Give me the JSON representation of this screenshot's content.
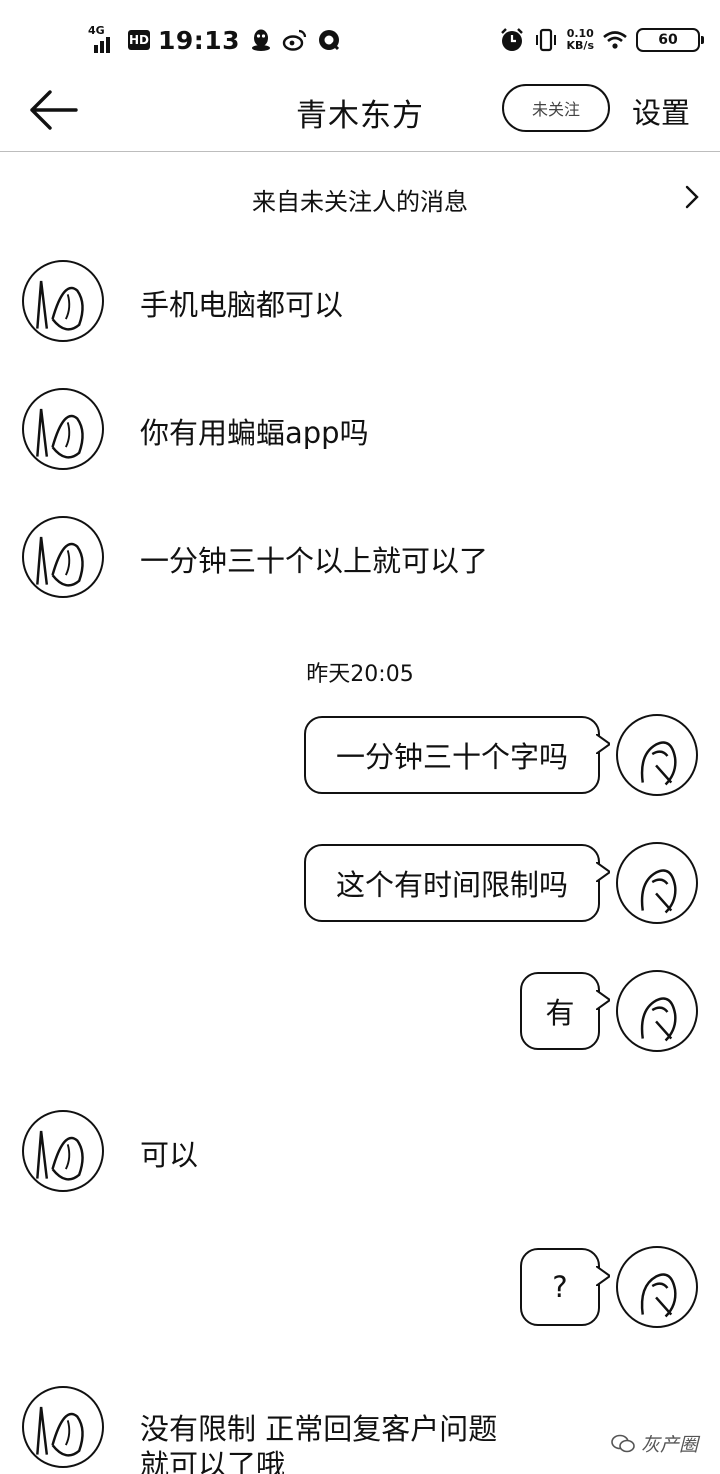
{
  "status_bar": {
    "network": "4G",
    "hd_badge": "HD",
    "time": "19:13",
    "speed_value": "0.10",
    "speed_unit": "KB/s",
    "battery": "60"
  },
  "header": {
    "title": "青木东方",
    "follow_label": "未关注",
    "settings_label": "设置"
  },
  "stranger_bar": {
    "label": "来自未关注人的消息"
  },
  "timestamp": "昨天20:05",
  "messages": [
    {
      "side": "in",
      "text": "手机电脑都可以"
    },
    {
      "side": "in",
      "text": "你有用蝙蝠app吗"
    },
    {
      "side": "in",
      "text": "一分钟三十个以上就可以了"
    },
    {
      "side": "out",
      "text": "一分钟三十个字吗"
    },
    {
      "side": "out",
      "text": "这个有时间限制吗"
    },
    {
      "side": "out",
      "text": "有"
    },
    {
      "side": "in",
      "text": "可以"
    },
    {
      "side": "out",
      "text": "?"
    },
    {
      "side": "in",
      "text": "没有限制 正常回复客户问题"
    },
    {
      "side": "in",
      "text_line2": "就可以了哦"
    }
  ],
  "watermark": "灰产圈",
  "icons": [
    "back-arrow-icon",
    "chevron-right-icon",
    "wifi-icon",
    "alarm-icon",
    "vibrate-icon",
    "qq-icon",
    "weibo-icon"
  ]
}
